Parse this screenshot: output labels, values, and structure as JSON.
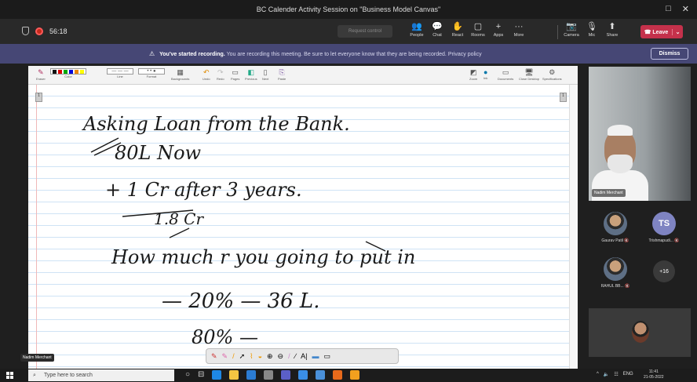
{
  "window": {
    "title": "BC Calender Activity Session on \"Business Model Canvas\"",
    "minimize_glyph": "□",
    "close_glyph": "✕"
  },
  "meeting": {
    "timer": "56:18",
    "request_control": "Request control",
    "toolbar": [
      {
        "icon": "people-icon",
        "glyph": "👥",
        "label": "People"
      },
      {
        "icon": "chat-icon",
        "glyph": "💬",
        "label": "Chat"
      },
      {
        "icon": "react-icon",
        "glyph": "✋",
        "label": "React"
      },
      {
        "icon": "rooms-icon",
        "glyph": "▢",
        "label": "Rooms"
      },
      {
        "icon": "apps-icon",
        "glyph": "+",
        "label": "Apps"
      },
      {
        "icon": "more-icon",
        "glyph": "···",
        "label": "More"
      }
    ],
    "toolbar_right": [
      {
        "icon": "camera-icon",
        "glyph": "📷",
        "label": "Camera"
      },
      {
        "icon": "mic-icon",
        "glyph": "🎙",
        "label": "Mic"
      },
      {
        "icon": "share-icon",
        "glyph": "⬆",
        "label": "Share"
      }
    ],
    "leave_label": "Leave",
    "leave_color": "#c4314b"
  },
  "banner": {
    "bold": "You've started recording.",
    "rest": "You are recording this meeting. Be sure to let everyone know that they are being recorded. Privacy policy",
    "dismiss": "Dismiss",
    "color": "#464775"
  },
  "ribbon": {
    "groups": [
      "Eraser",
      "Color",
      "Line",
      "Format",
      "Backgrounds",
      "Undo",
      "Redo",
      "Pages",
      "Previous",
      "Next",
      "Paste",
      "Zoom",
      "Ink",
      "Documents",
      "Close Desktop",
      "Specifications"
    ]
  },
  "notes": [
    "Asking Loan from the Bank.",
    "80L  Now",
    "+ 1 Cr   after 3 years.",
    "1.8 Cr",
    "How much r you going to put in",
    "— 20%  — 36 L.",
    "80%  —"
  ],
  "board_name_tag": "Nadim Merchant",
  "presenter": {
    "name": "Nadim Merchant"
  },
  "participants": [
    {
      "name": "Gaurav Patil",
      "avatar": "photo"
    },
    {
      "name": "Trishmapudi...",
      "avatar": "initials",
      "initials": "TS"
    },
    {
      "name": "RAHUL BB...",
      "avatar": "photo"
    },
    {
      "name": "",
      "avatar": "more",
      "count": "+16"
    }
  ],
  "taskbar": {
    "search_placeholder": "Type here to search",
    "lang": "ENG",
    "time": "11:41",
    "date": "21-05-2022"
  }
}
